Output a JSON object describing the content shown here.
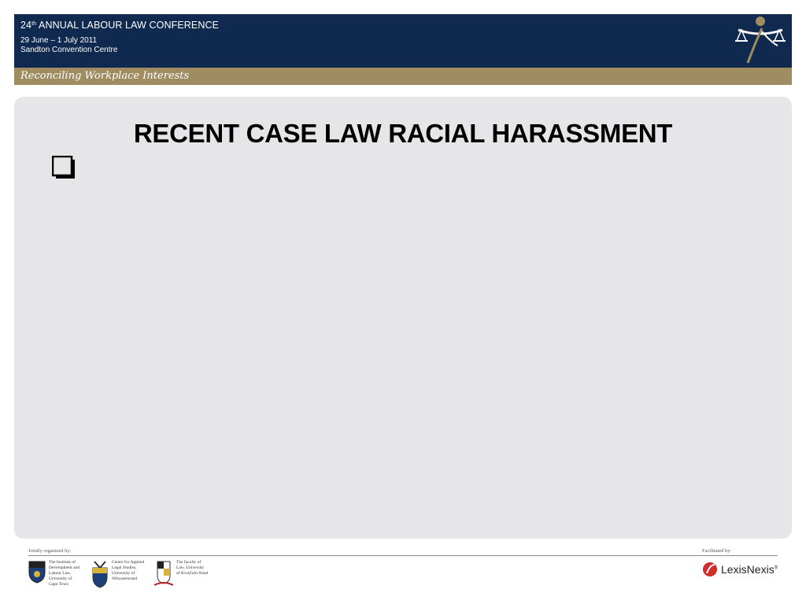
{
  "header": {
    "title_number": "24",
    "title_suffix": "th",
    "title_rest": " ANNUAL LABOUR LAW CONFERENCE",
    "dates": "29 June – 1 July 2011",
    "venue": "Sandton Convention Centre",
    "tagline": "Reconciling Workplace Interests",
    "brand_color": "#10294f",
    "tagline_color": "#a08c61",
    "logo_icon": "scales-of-justice-figure-icon"
  },
  "slide": {
    "title": "RECENT CASE LAW RACIAL HARASSMENT",
    "bullet_icon": "checkbox-square-icon",
    "background": "#e6e6e8"
  },
  "footer": {
    "organised_label": "Jointly organised by:",
    "facilitated_label": "Facilitated by:",
    "organisers": [
      {
        "lines": [
          "The Institute of",
          "Development and",
          "Labour Law,",
          "University of",
          "Cape Town"
        ],
        "icon": "uct-crest-icon"
      },
      {
        "lines": [
          "Centre for Applied",
          "Legal Studies,",
          "University of",
          "Witwatersrand"
        ],
        "icon": "wits-crest-icon"
      },
      {
        "lines": [
          "The faculty of",
          "Law, University",
          "of KwaZulu-Natal"
        ],
        "icon": "ukzn-crest-icon"
      }
    ],
    "facilitator": {
      "name": "LexisNexis",
      "mark": "®",
      "icon": "lexisnexis-logo-icon"
    }
  }
}
